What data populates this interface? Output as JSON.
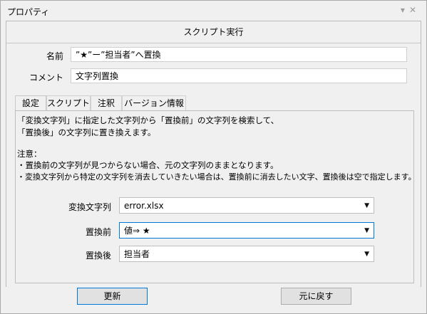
{
  "window": {
    "title": "プロパティ",
    "controls_hint": "▾ ✕"
  },
  "header": {
    "title": "スクリプト実行"
  },
  "form": {
    "name_label": "名前",
    "name_value": "”★”ー”担当者”へ置換",
    "comment_label": "コメント",
    "comment_value": "文字列置換"
  },
  "tabs": [
    {
      "label": "設定",
      "active": true
    },
    {
      "label": "スクリプト",
      "active": false
    },
    {
      "label": "注釈",
      "active": false
    },
    {
      "label": "バージョン情報",
      "active": false
    }
  ],
  "settings": {
    "desc_line1": "「変換文字列」に指定した文字列から「置換前」の文字列を検索して、",
    "desc_line2": "「置換後」の文字列に置き換えます。",
    "note_title": "注意：",
    "note_line1": "・置換前の文字列が見つからない場合、元の文字列のままとなります。",
    "note_line2": "・変換文字列から特定の文字列を消去していきたい場合は、置換前に消去したい文字、置換後は空で指定します。",
    "rows": [
      {
        "label": "変換文字列",
        "value": "error.xlsx"
      },
      {
        "label": "置換前",
        "value": "値⇒ ★"
      },
      {
        "label": "置換後",
        "value": "担当者"
      }
    ]
  },
  "buttons": {
    "update": "更新",
    "revert": "元に戻す"
  },
  "colors": {
    "focus_border": "#0078d7",
    "window_bg": "#f0f0f0"
  }
}
